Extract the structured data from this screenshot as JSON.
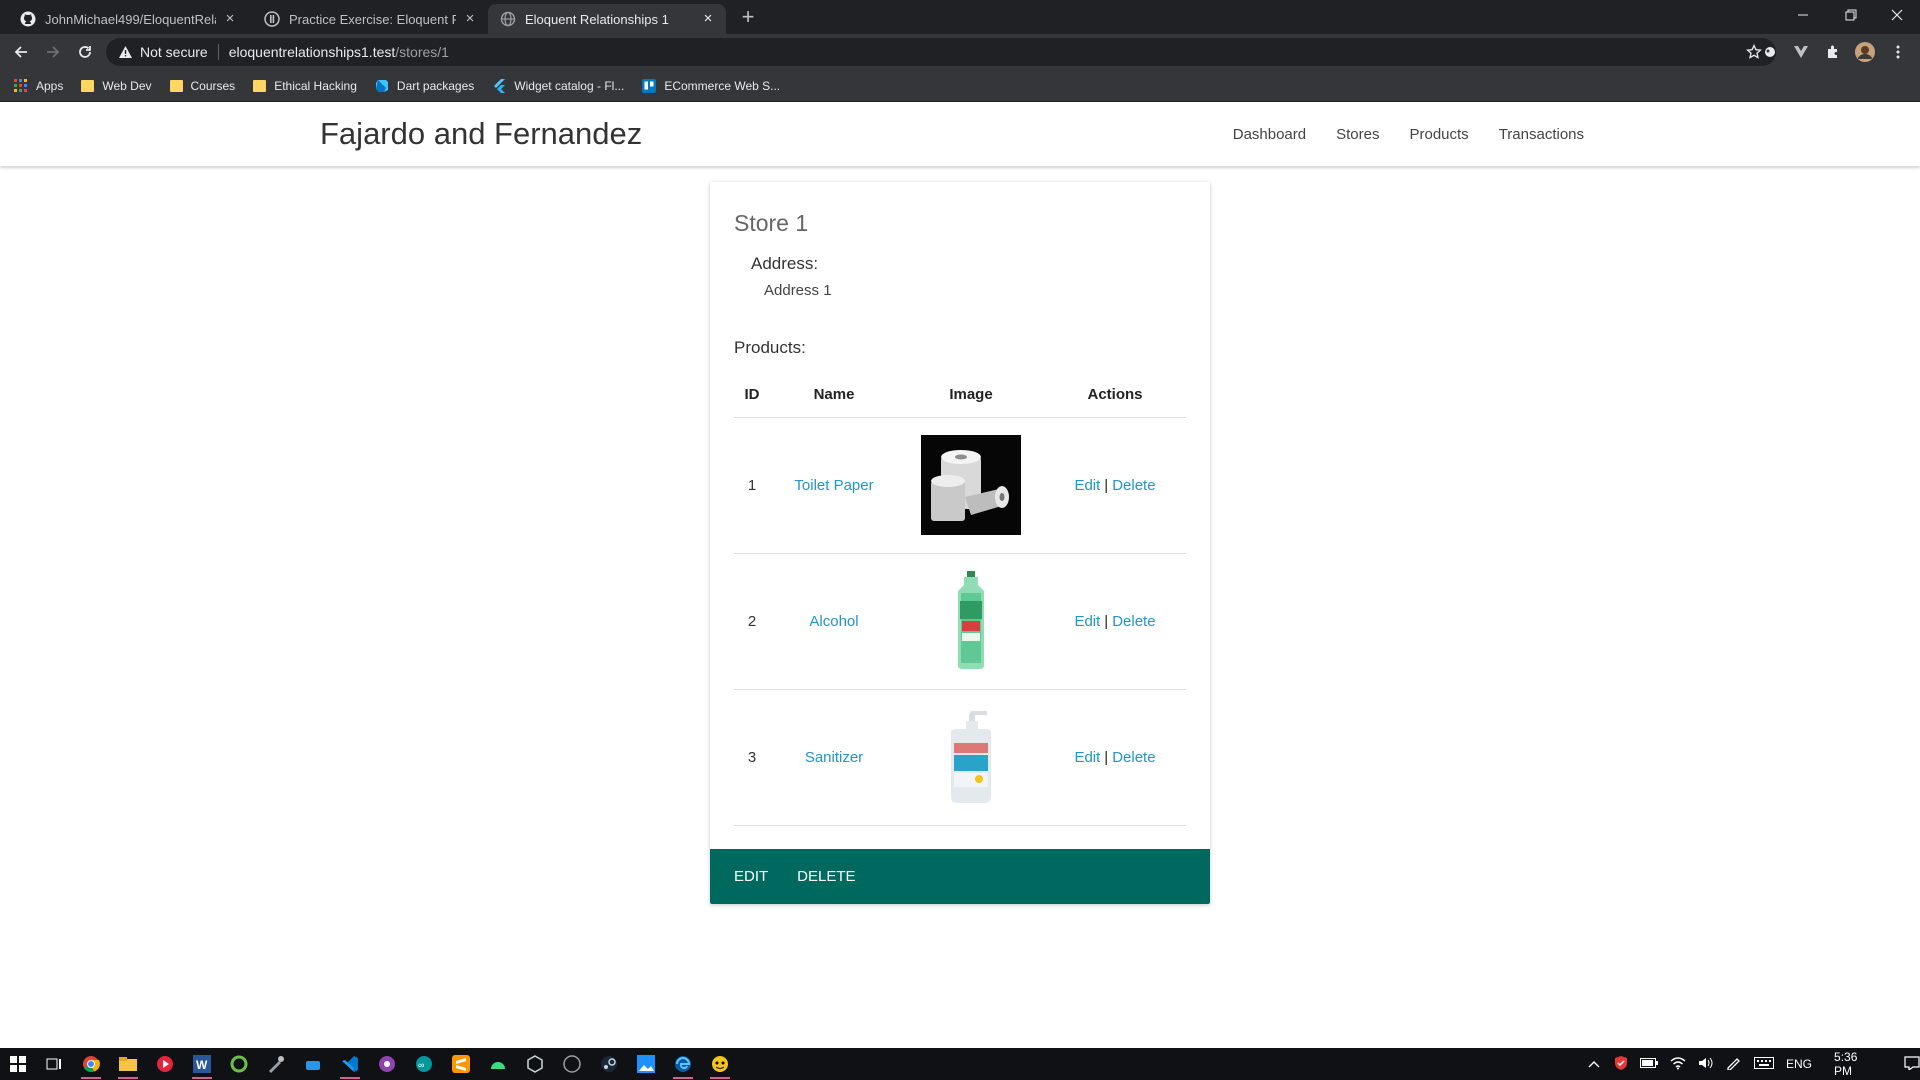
{
  "browser": {
    "tabs": [
      {
        "title": "JohnMichael499/EloquentRelatio",
        "favicon": "github-icon",
        "active": false
      },
      {
        "title": "Practice Exercise: Eloquent Relati",
        "favicon": "course-icon",
        "active": false
      },
      {
        "title": "Eloquent Relationships 1",
        "favicon": "globe-icon",
        "active": true
      }
    ],
    "security_label": "Not secure",
    "url_host": "eloquentrelationships1.test",
    "url_path": "/stores/1",
    "bookmarks": [
      {
        "label": "Apps",
        "icon": "apps-grid-icon"
      },
      {
        "label": "Web Dev",
        "icon": "folder-icon"
      },
      {
        "label": "Courses",
        "icon": "folder-icon"
      },
      {
        "label": "Ethical Hacking",
        "icon": "folder-icon"
      },
      {
        "label": "Dart packages",
        "icon": "dart-icon"
      },
      {
        "label": "Widget catalog - Fl...",
        "icon": "flutter-icon"
      },
      {
        "label": "ECommerce Web S...",
        "icon": "trello-icon"
      }
    ]
  },
  "site": {
    "brand": "Fajardo and Fernandez",
    "nav": [
      "Dashboard",
      "Stores",
      "Products",
      "Transactions"
    ]
  },
  "store": {
    "title": "Store 1",
    "address_label": "Address:",
    "address_value": "Address 1",
    "products_label": "Products:",
    "table_headers": [
      "ID",
      "Name",
      "Image",
      "Actions"
    ],
    "products": [
      {
        "id": "1",
        "name": "Toilet Paper",
        "image": "toilet-paper-image",
        "edit": "Edit",
        "sep": "|",
        "delete": "Delete"
      },
      {
        "id": "2",
        "name": "Alcohol",
        "image": "alcohol-bottle-image",
        "edit": "Edit",
        "sep": "|",
        "delete": "Delete"
      },
      {
        "id": "3",
        "name": "Sanitizer",
        "image": "sanitizer-bottle-image",
        "edit": "Edit",
        "sep": "|",
        "delete": "Delete"
      }
    ],
    "actions": {
      "edit": "EDIT",
      "delete": "DELETE"
    }
  },
  "taskbar": {
    "language": "ENG",
    "time": "5:36 PM"
  },
  "colors": {
    "accent": "#00695f",
    "link": "#2196c8",
    "chrome_dark": "#202124",
    "chrome_toolbar": "#35363a"
  }
}
